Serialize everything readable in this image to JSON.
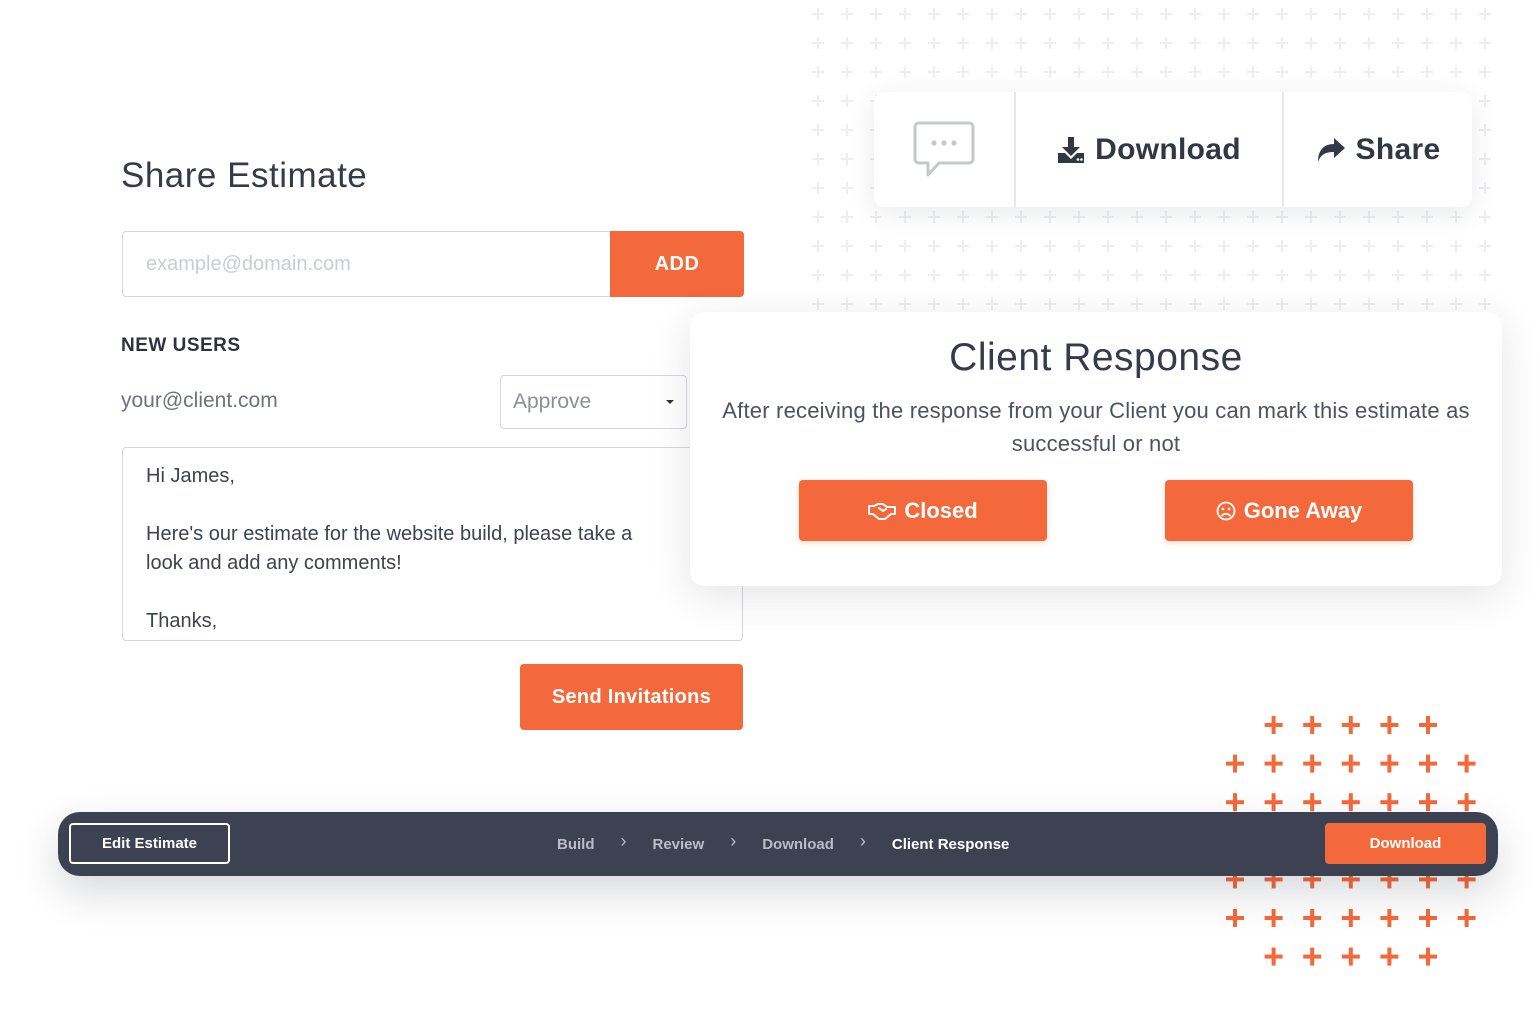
{
  "share_estimate": {
    "title": "Share Estimate",
    "email_placeholder": "example@domain.com",
    "add_label": "ADD",
    "new_users_label": "NEW USERS",
    "user_email": "your@client.com",
    "role_selected": "Approve",
    "message_lines": [
      "Hi James,",
      "",
      "Here's our estimate for the website build, please take a",
      "look and add any comments!",
      "",
      "Thanks,"
    ],
    "send_label": "Send Invitations"
  },
  "actions": {
    "chat_icon": "chat-bubble-icon",
    "download_label": "Download",
    "share_label": "Share"
  },
  "client_response": {
    "title": "Client Response",
    "description": "After receiving the response from your Client you can mark this estimate as successful or not",
    "closed_label": "Closed",
    "gone_away_label": "Gone Away"
  },
  "bottom_bar": {
    "edit_label": "Edit Estimate",
    "steps": [
      "Build",
      "Review",
      "Download",
      "Client Response"
    ],
    "active_step": "Client Response",
    "download_label": "Download"
  },
  "colors": {
    "accent": "#f4693c",
    "dark": "#3d4252",
    "pattern_grey": "#eceef1"
  }
}
